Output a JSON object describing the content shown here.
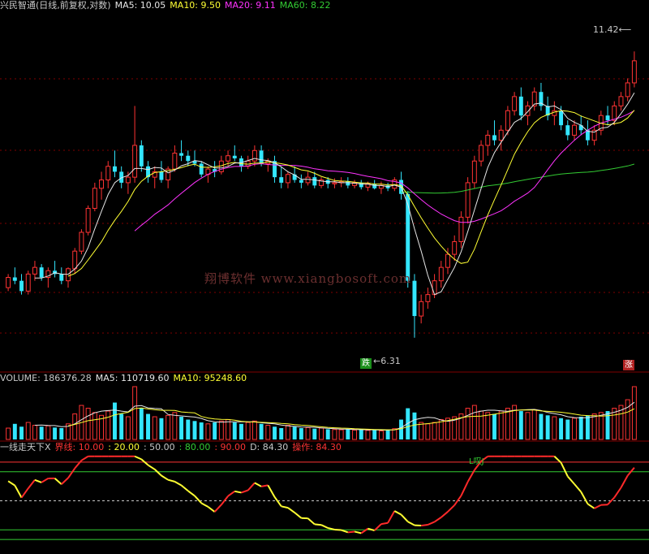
{
  "colors": {
    "up": "#ff3333",
    "down": "#33e6ff",
    "ma5": "#e6e6e6",
    "ma10": "#ffff33",
    "ma20": "#ff33ff",
    "ma60": "#33cc33",
    "label": "#c8c8c8",
    "grid": "#800000",
    "zone_line": "#33cc33",
    "rise_curve": "#ff2a2a",
    "fall_curve": "#ffff33"
  },
  "main": {
    "title": "兴民智通(日线,前复权,对数)",
    "ma5_label": "MA5: 10.05",
    "ma10_label": "MA10: 9.50",
    "ma20_label": "MA20: 9.11",
    "ma60_label": "MA60: 8.22",
    "high_marker": "11.42",
    "low_marker": "6.31",
    "down_badge": "跌",
    "up_badge": "涨",
    "watermark": "翔博软件 www.xiangbosoft.com"
  },
  "volume": {
    "label": "VOLUME: 186376.28",
    "ma5_label": "MA5: 110719.60",
    "ma10_label": "MA10: 95248.60"
  },
  "indicator": {
    "name": "一线走天下X",
    "bound_label": "界线: 10.00",
    "b20": ": 20.00",
    "b50": ": 50.00",
    "b80": ": 80.00",
    "b90": ": 90.00",
    "d_label": "D: 84.30",
    "op_label": "操作: 84.30",
    "top_marker": "L叹J"
  },
  "chart_data": {
    "type": "candlestick",
    "price_scale": "log",
    "price_high": 11.42,
    "price_low": 6.31,
    "candles": [
      [
        7.0,
        7.2,
        6.95,
        7.15
      ],
      [
        7.15,
        7.3,
        7.05,
        7.1
      ],
      [
        7.1,
        7.2,
        6.9,
        6.95
      ],
      [
        6.95,
        7.25,
        6.9,
        7.2
      ],
      [
        7.2,
        7.4,
        7.1,
        7.3
      ],
      [
        7.3,
        7.35,
        7.1,
        7.15
      ],
      [
        7.15,
        7.3,
        7.0,
        7.25
      ],
      [
        7.25,
        7.4,
        7.15,
        7.2
      ],
      [
        7.2,
        7.3,
        7.05,
        7.1
      ],
      [
        7.1,
        7.3,
        7.0,
        7.28
      ],
      [
        7.28,
        7.6,
        7.2,
        7.55
      ],
      [
        7.55,
        7.9,
        7.5,
        7.85
      ],
      [
        7.85,
        8.3,
        7.8,
        8.25
      ],
      [
        8.25,
        8.7,
        8.2,
        8.6
      ],
      [
        8.6,
        8.9,
        8.4,
        8.75
      ],
      [
        8.75,
        9.1,
        8.6,
        9.0
      ],
      [
        9.0,
        9.3,
        8.8,
        8.9
      ],
      [
        8.9,
        9.0,
        8.6,
        8.7
      ],
      [
        8.7,
        8.9,
        8.5,
        8.8
      ],
      [
        8.8,
        10.2,
        8.7,
        9.4
      ],
      [
        9.4,
        9.5,
        8.9,
        9.0
      ],
      [
        9.0,
        9.1,
        8.7,
        8.8
      ],
      [
        8.8,
        9.0,
        8.6,
        8.9
      ],
      [
        8.9,
        9.1,
        8.7,
        8.75
      ],
      [
        8.75,
        9.0,
        8.6,
        8.95
      ],
      [
        8.95,
        9.4,
        8.9,
        9.25
      ],
      [
        9.25,
        9.5,
        9.1,
        9.2
      ],
      [
        9.2,
        9.3,
        9.0,
        9.1
      ],
      [
        9.1,
        9.3,
        9.0,
        9.05
      ],
      [
        9.05,
        9.1,
        8.8,
        8.85
      ],
      [
        8.85,
        9.0,
        8.7,
        8.95
      ],
      [
        8.95,
        9.1,
        8.8,
        8.9
      ],
      [
        8.9,
        9.2,
        8.85,
        9.1
      ],
      [
        9.1,
        9.3,
        9.0,
        9.2
      ],
      [
        9.2,
        9.4,
        9.1,
        9.15
      ],
      [
        9.15,
        9.2,
        8.9,
        9.0
      ],
      [
        9.0,
        9.2,
        8.95,
        9.1
      ],
      [
        9.1,
        9.4,
        9.0,
        9.3
      ],
      [
        9.3,
        9.4,
        9.0,
        9.05
      ],
      [
        9.05,
        9.15,
        8.9,
        9.1
      ],
      [
        9.1,
        9.2,
        8.7,
        8.8
      ],
      [
        8.8,
        9.0,
        8.6,
        8.7
      ],
      [
        8.7,
        8.9,
        8.6,
        8.85
      ],
      [
        8.85,
        9.0,
        8.7,
        8.75
      ],
      [
        8.75,
        8.85,
        8.6,
        8.7
      ],
      [
        8.7,
        8.9,
        8.65,
        8.8
      ],
      [
        8.8,
        8.9,
        8.6,
        8.65
      ],
      [
        8.65,
        8.8,
        8.6,
        8.75
      ],
      [
        8.75,
        8.8,
        8.6,
        8.68
      ],
      [
        8.68,
        8.78,
        8.6,
        8.7
      ],
      [
        8.7,
        8.8,
        8.62,
        8.72
      ],
      [
        8.72,
        8.8,
        8.6,
        8.65
      ],
      [
        8.65,
        8.75,
        8.6,
        8.7
      ],
      [
        8.7,
        8.75,
        8.58,
        8.62
      ],
      [
        8.62,
        8.72,
        8.55,
        8.68
      ],
      [
        8.68,
        8.75,
        8.58,
        8.6
      ],
      [
        8.6,
        8.72,
        8.5,
        8.65
      ],
      [
        8.65,
        8.7,
        8.55,
        8.6
      ],
      [
        8.6,
        8.8,
        8.55,
        8.75
      ],
      [
        8.75,
        8.9,
        8.4,
        8.5
      ],
      [
        8.5,
        8.55,
        7.0,
        7.1
      ],
      [
        7.1,
        7.2,
        6.31,
        6.6
      ],
      [
        6.6,
        6.9,
        6.5,
        6.8
      ],
      [
        6.8,
        7.0,
        6.7,
        6.9
      ],
      [
        6.9,
        7.2,
        6.85,
        7.1
      ],
      [
        7.1,
        7.4,
        7.0,
        7.3
      ],
      [
        7.3,
        7.6,
        7.2,
        7.5
      ],
      [
        7.5,
        7.8,
        7.4,
        7.7
      ],
      [
        7.7,
        8.2,
        7.6,
        8.1
      ],
      [
        8.1,
        8.8,
        8.0,
        8.7
      ],
      [
        8.7,
        9.2,
        8.6,
        9.1
      ],
      [
        9.1,
        9.5,
        9.0,
        9.4
      ],
      [
        9.4,
        9.7,
        9.2,
        9.6
      ],
      [
        9.6,
        9.9,
        9.4,
        9.5
      ],
      [
        9.5,
        9.8,
        9.3,
        9.7
      ],
      [
        9.7,
        10.2,
        9.6,
        10.1
      ],
      [
        10.1,
        10.5,
        10.0,
        10.4
      ],
      [
        10.4,
        10.6,
        9.9,
        10.0
      ],
      [
        10.0,
        10.3,
        9.8,
        10.2
      ],
      [
        10.2,
        10.6,
        10.1,
        10.5
      ],
      [
        10.5,
        10.7,
        10.1,
        10.2
      ],
      [
        10.2,
        10.4,
        9.9,
        10.0
      ],
      [
        10.0,
        10.3,
        9.8,
        10.1
      ],
      [
        10.1,
        10.2,
        9.7,
        9.8
      ],
      [
        9.8,
        9.9,
        9.5,
        9.6
      ],
      [
        9.6,
        9.9,
        9.5,
        9.8
      ],
      [
        9.8,
        10.0,
        9.6,
        9.7
      ],
      [
        9.7,
        9.9,
        9.4,
        9.5
      ],
      [
        9.5,
        9.8,
        9.4,
        9.7
      ],
      [
        9.7,
        10.1,
        9.6,
        10.0
      ],
      [
        10.0,
        10.2,
        9.8,
        9.9
      ],
      [
        9.9,
        10.3,
        9.8,
        10.2
      ],
      [
        10.2,
        10.5,
        10.1,
        10.4
      ],
      [
        10.4,
        10.8,
        10.3,
        10.7
      ],
      [
        10.7,
        11.42,
        10.6,
        11.2
      ]
    ],
    "volume": [
      40,
      55,
      45,
      60,
      50,
      45,
      48,
      42,
      40,
      55,
      90,
      120,
      110,
      95,
      85,
      100,
      130,
      90,
      80,
      186,
      110,
      90,
      80,
      75,
      85,
      95,
      80,
      70,
      65,
      60,
      55,
      60,
      65,
      70,
      60,
      55,
      60,
      65,
      55,
      50,
      45,
      40,
      50,
      45,
      40,
      42,
      38,
      40,
      36,
      35,
      34,
      36,
      33,
      35,
      32,
      34,
      30,
      35,
      38,
      70,
      110,
      95,
      60,
      55,
      60,
      70,
      75,
      80,
      90,
      110,
      120,
      100,
      95,
      90,
      100,
      110,
      120,
      100,
      95,
      105,
      90,
      85,
      80,
      75,
      70,
      75,
      80,
      85,
      90,
      95,
      100,
      110,
      120,
      140,
      186
    ],
    "indicator_levels": [
      10,
      20,
      50,
      80,
      90
    ],
    "indicator_d": 84.3,
    "indicator_op": 84.3
  }
}
